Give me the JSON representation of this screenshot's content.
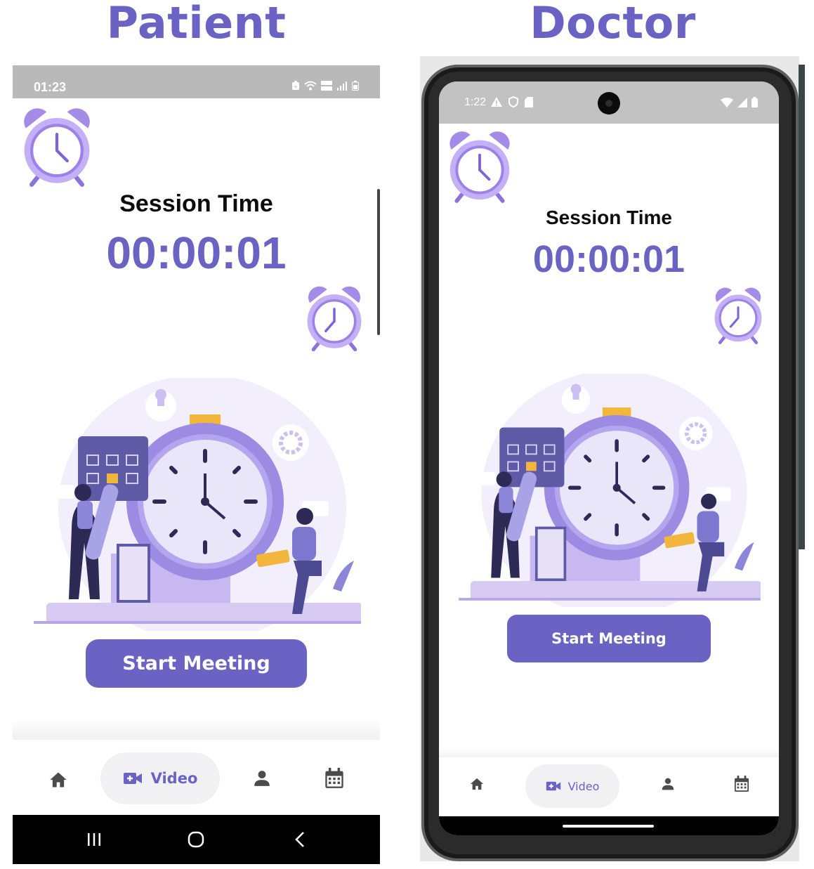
{
  "headings": {
    "patient": "Patient",
    "doctor": "Doctor"
  },
  "colors": {
    "accent": "#6a63c4",
    "nav_pill": "#f1f1f4",
    "status_bar": "#b9b9b9",
    "clock": "#b39cf0"
  },
  "patient": {
    "status_time": "01:23",
    "status_icons": [
      "battery-saver-icon",
      "wifi-icon",
      "volte-icon",
      "signal-icon",
      "battery-icon"
    ],
    "session_label": "Session Time",
    "timer": "00:00:01",
    "start_button": "Start Meeting",
    "nav": {
      "items": [
        {
          "icon": "home-icon",
          "label": ""
        },
        {
          "icon": "video-add-icon",
          "label": "Video",
          "selected": true
        },
        {
          "icon": "person-icon",
          "label": ""
        },
        {
          "icon": "calendar-icon",
          "label": ""
        }
      ]
    },
    "system_nav": [
      "recents-icon",
      "home-circle-icon",
      "back-icon"
    ]
  },
  "doctor": {
    "status_time": "1:22",
    "status_icons_left": [
      "warning-icon",
      "shield-icon",
      "sd-card-icon"
    ],
    "status_icons_right": [
      "wifi-icon",
      "signal-icon",
      "battery-icon"
    ],
    "session_label": "Session Time",
    "timer": "00:00:01",
    "start_button": "Start Meeting",
    "nav": {
      "items": [
        {
          "icon": "home-icon",
          "label": ""
        },
        {
          "icon": "video-add-icon",
          "label": "Video",
          "selected": true
        },
        {
          "icon": "person-icon",
          "label": ""
        },
        {
          "icon": "calendar-icon",
          "label": ""
        }
      ]
    }
  }
}
